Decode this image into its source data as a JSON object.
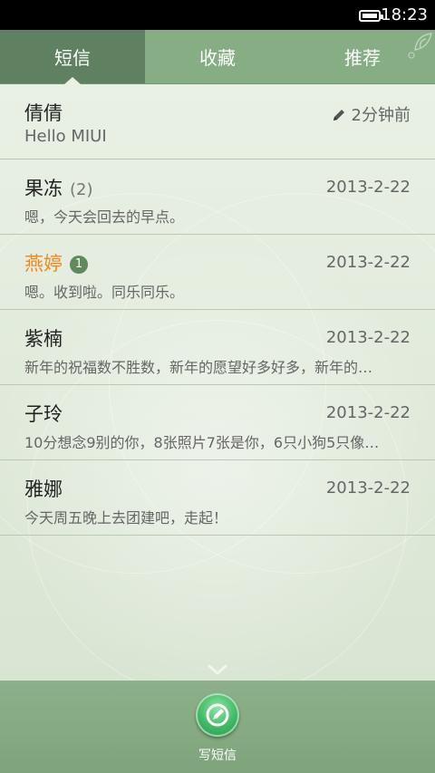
{
  "status_bar": {
    "time": "18:23",
    "battery_level": 1.0
  },
  "tabs": [
    {
      "label": "短信",
      "active": true
    },
    {
      "label": "收藏",
      "active": false
    },
    {
      "label": "推荐",
      "active": false
    }
  ],
  "threads": [
    {
      "name": "倩倩",
      "count": "",
      "badge": "",
      "date": "2分钟前",
      "draft_icon": "pencil-icon",
      "snippet": "Hello MIUI",
      "unread": false
    },
    {
      "name": "果冻",
      "count": "(2)",
      "badge": "",
      "date": "2013-2-22",
      "draft_icon": "",
      "snippet": "嗯，今天会回去的早点。",
      "unread": false
    },
    {
      "name": "燕婷",
      "count": "",
      "badge": "1",
      "date": "2013-2-22",
      "draft_icon": "",
      "snippet": "嗯。收到啦。同乐同乐。",
      "unread": true
    },
    {
      "name": "紫楠",
      "count": "",
      "badge": "",
      "date": "2013-2-22",
      "draft_icon": "",
      "snippet": "新年的祝福数不胜数，新年的愿望好多好多，新年的…",
      "unread": false
    },
    {
      "name": "子玲",
      "count": "",
      "badge": "",
      "date": "2013-2-22",
      "draft_icon": "",
      "snippet": "10分想念9别的你，8张照片7张是你，6只小狗5只像…",
      "unread": false
    },
    {
      "name": "雅娜",
      "count": "",
      "badge": "",
      "date": "2013-2-22",
      "draft_icon": "",
      "snippet": "今天周五晚上去团建吧，走起！",
      "unread": false
    }
  ],
  "bottom": {
    "compose_label": "写短信",
    "compose_icon": "compose-icon"
  },
  "colors": {
    "accent": "#86ad84",
    "active_tab": "#5f8161",
    "unread_name": "#ef8a1f",
    "badge": "#5e8a5e",
    "compose": "#3fb864"
  }
}
